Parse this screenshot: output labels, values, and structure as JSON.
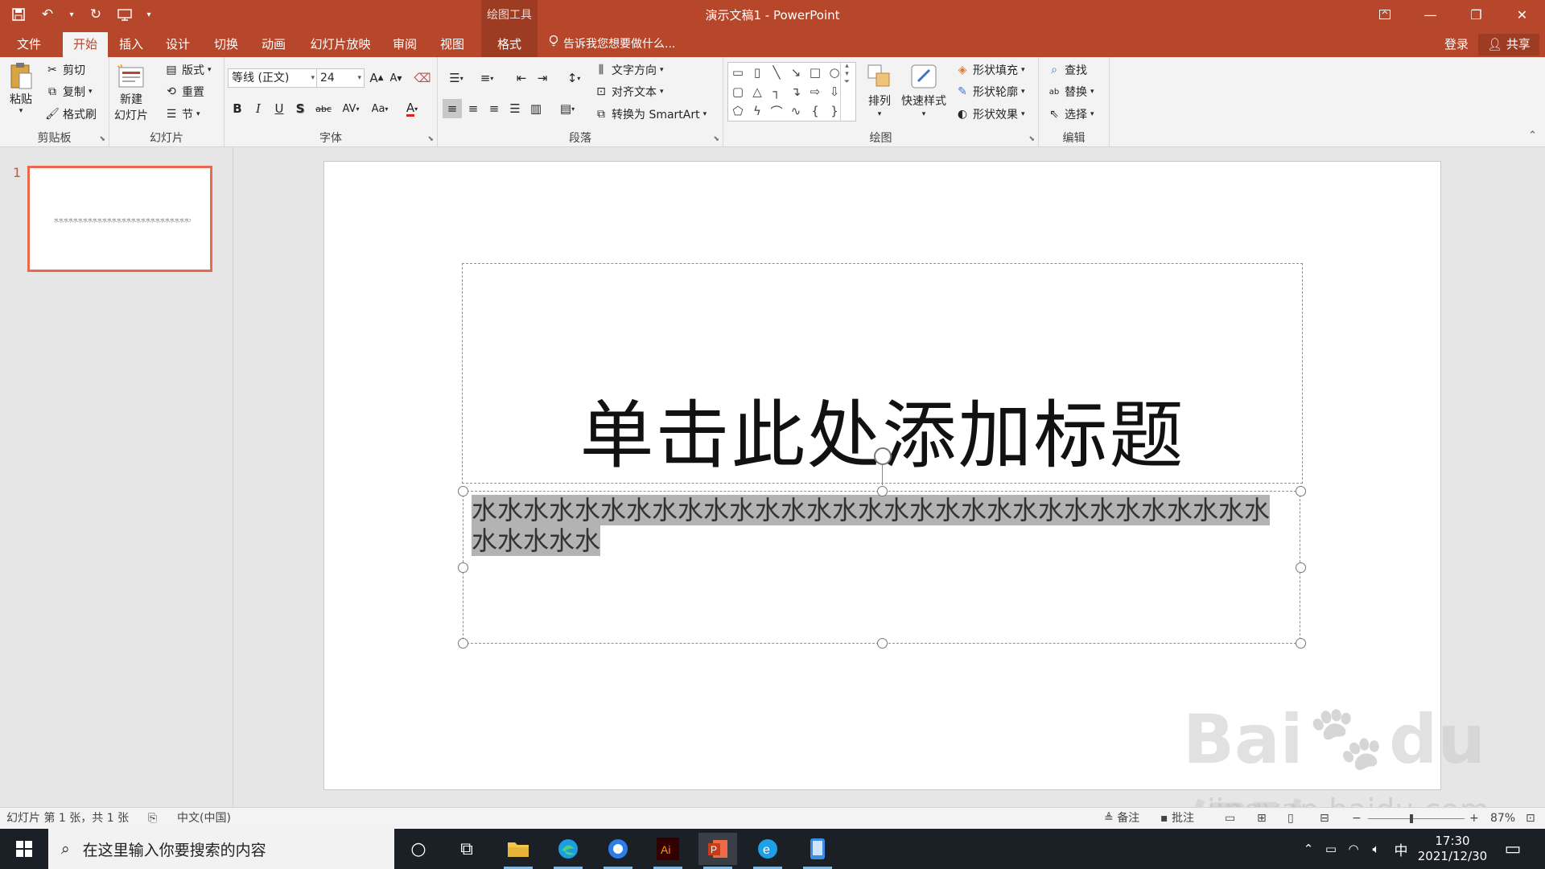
{
  "title_bar": {
    "title": "演示文稿1 - PowerPoint",
    "context_group": "绘图工具",
    "accent_color": "#b7472a"
  },
  "quick_access": [
    "save-icon",
    "undo-icon",
    "redo-icon",
    "present-icon"
  ],
  "tabs": [
    "文件",
    "开始",
    "插入",
    "设计",
    "切换",
    "动画",
    "幻灯片放映",
    "审阅",
    "视图",
    "格式"
  ],
  "active_tab": "开始",
  "tell_me": "告诉我您想要做什么...",
  "account": {
    "login": "登录",
    "share": "共享"
  },
  "ribbon": {
    "clipboard": {
      "label": "剪贴板",
      "paste": "粘贴",
      "cut": "剪切",
      "copy": "复制",
      "format_painter": "格式刷"
    },
    "slides": {
      "label": "幻灯片",
      "new_slide_line1": "新建",
      "new_slide_line2": "幻灯片",
      "layout": "版式",
      "reset": "重置",
      "section": "节"
    },
    "font": {
      "label": "字体",
      "font_name": "等线 (正文)",
      "font_size": "24",
      "bold": "B",
      "italic": "I",
      "underline": "U",
      "shadow": "S",
      "strike": "abc",
      "spacing": "AV",
      "case": "Aa",
      "color": "A",
      "grow": "A",
      "shrink": "A"
    },
    "paragraph": {
      "label": "段落",
      "text_direction": "文字方向",
      "align_text": "对齐文本",
      "convert_smartart": "转换为 SmartArt"
    },
    "drawing": {
      "label": "绘图",
      "arrange": "排列",
      "quick_styles": "快速样式",
      "shape_fill": "形状填充",
      "shape_outline": "形状轮廓",
      "shape_effects": "形状效果"
    },
    "editing": {
      "label": "编辑",
      "find": "查找",
      "replace": "替换",
      "select": "选择"
    }
  },
  "thumbnails": [
    {
      "number": "1",
      "preview_text": "水水水水水水水水水水水水水水水水水水水水水水水水水水水水水水水水水水水"
    }
  ],
  "slide": {
    "title_placeholder": "单击此处添加标题",
    "body_text": "水水水水水水水水水水水水水水水水水水水水水水水水水水水水水水水水水水水水"
  },
  "status_bar": {
    "slide_info": "幻灯片 第 1 张，共 1 张",
    "language": "中文(中国)",
    "notes": "备注",
    "comments": "批注",
    "zoom": "87%"
  },
  "taskbar": {
    "search_placeholder": "在这里输入你要搜索的内容",
    "apps": [
      "cortana-icon",
      "task-view-icon",
      "file-explorer-icon",
      "edge-icon",
      "browser-icon",
      "illustrator-icon",
      "powerpoint-icon",
      "ie-icon",
      "phone-icon"
    ],
    "ime": "中",
    "time": "17:30",
    "date": "2021/12/30"
  },
  "watermark": {
    "brand": "Baidu经验",
    "url": "jingyan.baidu.com"
  }
}
